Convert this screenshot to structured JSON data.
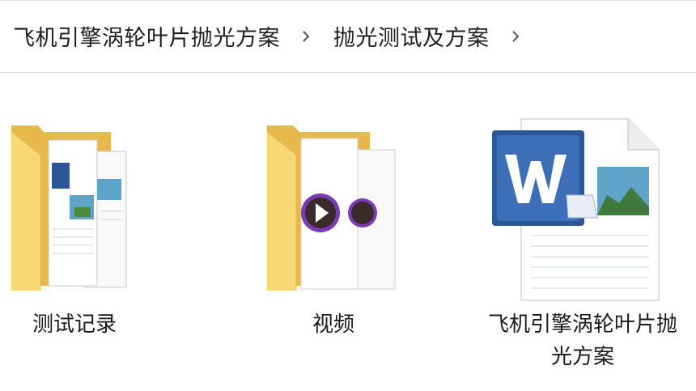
{
  "breadcrumb": {
    "items": [
      {
        "label": "飞机引擎涡轮叶片抛光方案"
      },
      {
        "label": "抛光测试及方案"
      }
    ]
  },
  "files": [
    {
      "name": "测试记录",
      "type": "folder",
      "icon": "folder-word-icon"
    },
    {
      "name": "视频",
      "type": "folder",
      "icon": "folder-video-icon"
    },
    {
      "name": "飞机引擎涡轮叶片抛光方案",
      "type": "docx",
      "icon": "word-document-icon"
    }
  ],
  "colors": {
    "folder_body": "#f8d775",
    "folder_back": "#e8b84a",
    "word_blue": "#2b5797",
    "video_purple": "#7a3bb5"
  }
}
